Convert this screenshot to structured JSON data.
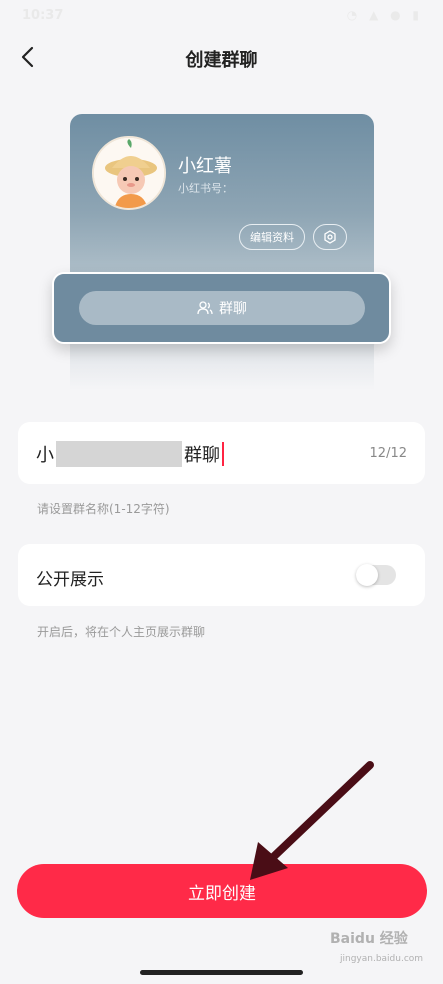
{
  "status_bar": {
    "time": "10:37",
    "icons": "◔ ▲ ● ▮"
  },
  "header": {
    "title": "创建群聊"
  },
  "preview": {
    "profile_name": "小红薯",
    "profile_id_label": "小红书号：",
    "edit_label": "编辑资料",
    "group_chat_label": "群聊"
  },
  "form": {
    "name_prefix": "小",
    "name_suffix": "群聊",
    "char_count": "12/12",
    "name_hint": "请设置群名称(1-12字符)",
    "public_label": "公开展示",
    "public_enabled": false,
    "public_hint": "开启后，将在个人主页展示群聊"
  },
  "actions": {
    "create_label": "立即创建"
  },
  "watermark": {
    "text": "Baidu 经验",
    "url": "jingyan.baidu.com"
  },
  "colors": {
    "accent": "#ff2a48",
    "card": "#6f8b9f"
  }
}
